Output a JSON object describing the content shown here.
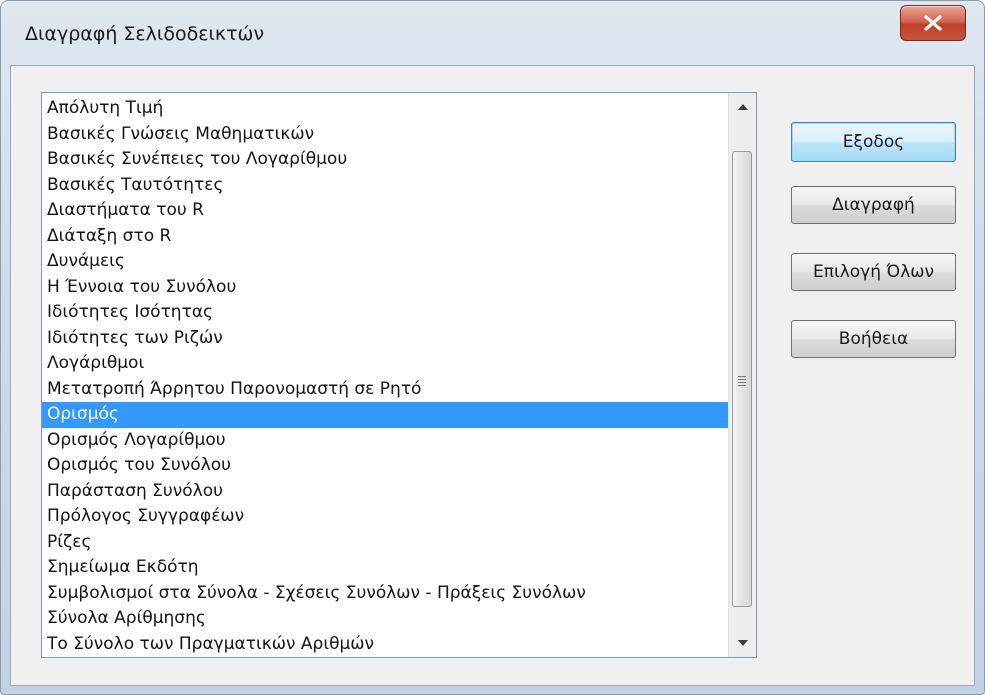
{
  "window": {
    "title": "Διαγραφή Σελιδοδεικτών"
  },
  "bookmarks": {
    "items": [
      "Απόλυτη Τιμή",
      "Βασικές Γνώσεις Μαθηματικών",
      "Βασικές Συνέπειες του Λογαρίθμου",
      "Βασικές Ταυτότητες",
      "Διαστήματα του R",
      "Διάταξη στο R",
      "Δυνάμεις",
      "Η Έννοια του Συνόλου",
      "Ιδιότητες Ισότητας",
      "Ιδιότητες των Ριζών",
      "Λογάριθμοι",
      "Μετατροπή Άρρητου Παρονομαστή σε Ρητό",
      "Ορισμός",
      "Ορισμός Λογαρίθμου",
      "Ορισμός του Συνόλου",
      "Παράσταση Συνόλου",
      "Πρόλογος Συγγραφέων",
      "Ρίζες",
      "Σημείωμα Εκδότη",
      "Συμβολισμοί στα Σύνολα - Σχέσεις Συνόλων - Πράξεις Συνόλων",
      "Σύνολα Αρίθμησης",
      "Το Σύνολο των Πραγματικών Αριθμών"
    ],
    "selected_index": 12
  },
  "buttons": {
    "exit": "Εξοδος",
    "delete": "Διαγραφή",
    "select_all": "Επιλογή Όλων",
    "help": "Βοήθεια"
  },
  "colors": {
    "selection": "#3399ff",
    "close_button": "#c9543d"
  },
  "icons": {
    "close": "close-x-icon",
    "scroll_up": "scroll-up-arrow-icon",
    "scroll_down": "scroll-down-arrow-icon"
  }
}
